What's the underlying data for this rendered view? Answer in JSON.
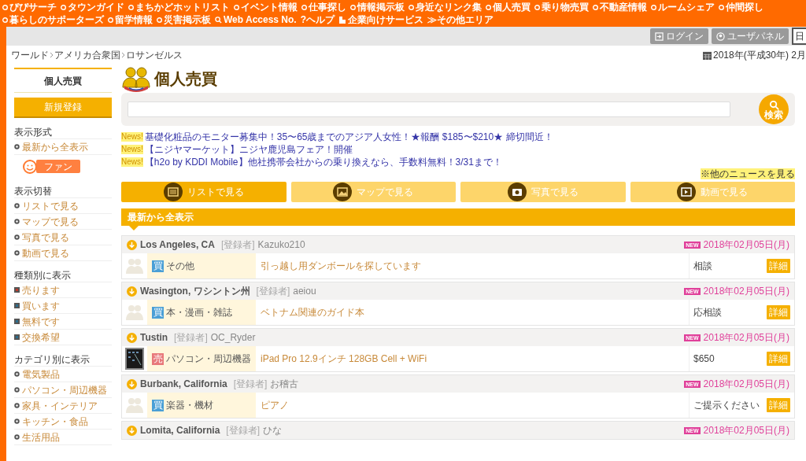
{
  "top_nav": {
    "row1": [
      "ぴぴサーチ",
      "タウンガイド",
      "まちかどホットリスト",
      "イベント情報",
      "仕事探し",
      "情報掲示板",
      "身近なリンク集",
      "個人売買",
      "乗り物売買",
      "不動産情報",
      "ルームシェア",
      "仲間探し",
      "暮らしのサポーターズ",
      "留学情報",
      "災害掲示板"
    ],
    "row2": [
      {
        "kind": "search",
        "label": "Web Access No."
      },
      {
        "kind": "text",
        "label": "?ヘルプ"
      },
      {
        "kind": "building",
        "label": "企業向けサービス"
      },
      {
        "kind": "text",
        "label": "≫その他エリア"
      }
    ]
  },
  "user_bar": {
    "buttons": [
      {
        "kind": "login",
        "label": "ログイン"
      },
      {
        "kind": "user",
        "label": "ユーザパネル"
      }
    ],
    "cut_button": "日"
  },
  "breadcrumb": [
    "ワールド",
    "アメリカ合衆国",
    "ロサンゼルス"
  ],
  "date": "2018年(平成30年) 2月",
  "sidebar": {
    "title": "個人売買",
    "register_button": "新規登録",
    "sections": [
      {
        "heading": "表示形式",
        "items": [
          {
            "label": "最新から全表示",
            "kind": "dot"
          }
        ],
        "fan": "ファン"
      },
      {
        "heading": "表示切替",
        "items": [
          {
            "label": "リストで見る",
            "kind": "dot"
          },
          {
            "label": "マップで見る",
            "kind": "dot"
          },
          {
            "label": "写真で見る",
            "kind": "dot"
          },
          {
            "label": "動画で見る",
            "kind": "dot"
          }
        ]
      },
      {
        "heading": "種類別に表示",
        "items": [
          {
            "label": "売ります",
            "kind": "square",
            "color": "#c0392b"
          },
          {
            "label": "買います",
            "kind": "square",
            "color": "#2c6e8e"
          },
          {
            "label": "無料です",
            "kind": "square",
            "color": "#2c6e8e"
          },
          {
            "label": "交換希望",
            "kind": "square",
            "color": "#2c6e8e"
          }
        ]
      },
      {
        "heading": "カテゴリ別に表示",
        "items": [
          {
            "label": "電気製品",
            "kind": "dot"
          },
          {
            "label": "パソコン・周辺機器",
            "kind": "dot"
          },
          {
            "label": "家具・インテリア",
            "kind": "dot"
          },
          {
            "label": "キッチン・食品",
            "kind": "dot"
          },
          {
            "label": "生活用品",
            "kind": "dot"
          }
        ]
      }
    ]
  },
  "main": {
    "title": "個人売買",
    "search": {
      "button": "検索"
    },
    "news": [
      {
        "badge": "News!",
        "text": "基礎化粧品のモニター募集中！35〜65歳までのアジア人女性！★報酬 $185〜$210★ 締切間近！"
      },
      {
        "badge": "News!",
        "text": "【ニジヤマーケット】ニジヤ鹿児島フェア！開催"
      },
      {
        "badge": "News!",
        "text": "【h2o by KDDI Mobile】他社携帯会社からの乗り換えなら、手数料無料！3/31まで！"
      }
    ],
    "more_news": "※他のニュースを見る",
    "view_tabs": [
      {
        "label": "リストで見る",
        "kind": "list",
        "selected": true
      },
      {
        "label": "マップで見る",
        "kind": "map",
        "selected": false
      },
      {
        "label": "写真で見る",
        "kind": "camera",
        "selected": false
      },
      {
        "label": "動画で見る",
        "kind": "video",
        "selected": false
      }
    ],
    "section_title": "最新から全表示",
    "listings": [
      {
        "location": "Los Angeles, CA",
        "registrant_label": "[登録者]",
        "registrant": "Kazuko210",
        "new": "NEW",
        "date": "2018年02月05日(月)",
        "type": "買",
        "color": "#4a9fd6",
        "kind": "placeholder",
        "category": "その他",
        "title": "引っ越し用ダンボールを探しています",
        "price": "相談",
        "detail": "詳細"
      },
      {
        "location": "Wasington, ワシントン州",
        "registrant_label": "[登録者]",
        "registrant": "aeiou",
        "new": "NEW",
        "date": "2018年02月05日(月)",
        "type": "買",
        "color": "#4a9fd6",
        "kind": "placeholder",
        "category": "本・漫画・雑誌",
        "title": "ベトナム関連のガイド本",
        "price": "応相談",
        "detail": "詳細"
      },
      {
        "location": "Tustin",
        "registrant_label": "[登録者]",
        "registrant": "OC_Ryder",
        "new": "NEW",
        "date": "2018年02月05日(月)",
        "type": "売",
        "color": "#e8787a",
        "kind": "picture",
        "category": "パソコン・周辺機器",
        "title": "iPad Pro 12.9インチ 128GB Cell + WiFi",
        "price": "$650",
        "detail": "詳細"
      },
      {
        "location": "Burbank, California",
        "registrant_label": "[登録者]",
        "registrant": "お稽古",
        "new": "NEW",
        "date": "2018年02月05日(月)",
        "type": "買",
        "color": "#4a9fd6",
        "kind": "placeholder",
        "category": "楽器・機材",
        "title": "ピアノ",
        "price": "ご提示ください",
        "detail": "詳細"
      },
      {
        "location": "Lomita, California",
        "registrant_label": "[登録者]",
        "registrant": "ひな",
        "new": "NEW",
        "date": "2018年02月05日(月)"
      }
    ]
  }
}
